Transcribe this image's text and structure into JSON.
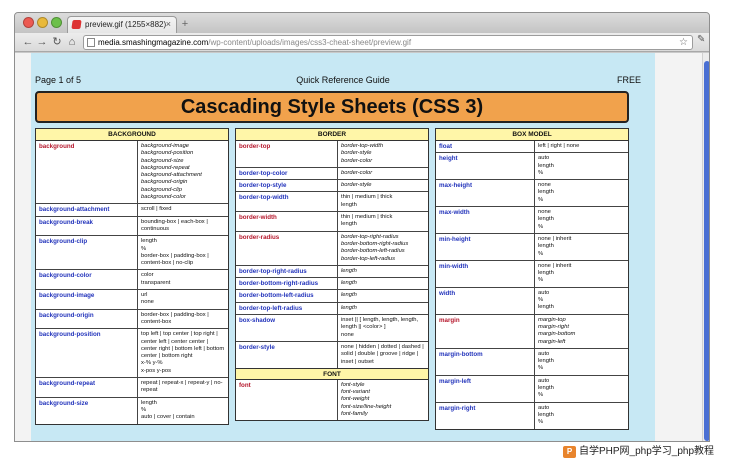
{
  "browser": {
    "tab_title": "preview.gif (1255×882)",
    "tab_close": "×",
    "new_tab": "+",
    "url_host": "media.smashingmagazine.com",
    "url_path": "/wp-content/uploads/images/css3-cheat-sheet/preview.gif",
    "back": "←",
    "forward": "→",
    "reload": "↻",
    "home": "⌂",
    "star": "☆",
    "wrench": "✎"
  },
  "page": {
    "page_label": "Page 1 of 5",
    "guide_label": "Quick Reference Guide",
    "free_label": "FREE",
    "title": "Cascading Style Sheets (CSS 3)"
  },
  "background": {
    "heading": "BACKGROUND",
    "rows": [
      {
        "prop": "background",
        "red": true,
        "italic": true,
        "val": "background-image\nbackground-position\nbackground-size\nbackground-repeat\nbackground-attachment\nbackground-origin\nbackground-clip\nbackground-color"
      },
      {
        "prop": "background-attachment",
        "red": false,
        "italic": false,
        "val": "scroll | fixed"
      },
      {
        "prop": "background-break",
        "red": false,
        "italic": false,
        "val": "bounding-box | each-box | continuous"
      },
      {
        "prop": "background-clip",
        "red": false,
        "italic": false,
        "val": "length\n%\nborder-box | padding-box | content-box | no-clip"
      },
      {
        "prop": "background-color",
        "red": false,
        "italic": false,
        "val": "color\ntransparent"
      },
      {
        "prop": "background-image",
        "red": false,
        "italic": false,
        "val": "url\nnone"
      },
      {
        "prop": "background-origin",
        "red": false,
        "italic": false,
        "val": "border-box | padding-box | content-box"
      },
      {
        "prop": "background-position",
        "red": false,
        "italic": false,
        "val": "top left | top center | top right | center left | center center | center right | bottom left | bottom center | bottom right\nx-% y-%\nx-pos y-pos"
      },
      {
        "prop": "background-repeat",
        "red": false,
        "italic": false,
        "val": "repeat | repeat-x | repeat-y | no-repeat"
      },
      {
        "prop": "background-size",
        "red": false,
        "italic": false,
        "val": "length\n%\nauto | cover | contain"
      }
    ]
  },
  "border": {
    "heading": "BORDER",
    "rows": [
      {
        "prop": "border-top",
        "red": true,
        "italic": true,
        "val": "border-top-width\nborder-style\nborder-color"
      },
      {
        "prop": "border-top-color",
        "red": false,
        "italic": true,
        "val": "border-color"
      },
      {
        "prop": "border-top-style",
        "red": false,
        "italic": true,
        "val": "border-style"
      },
      {
        "prop": "border-top-width",
        "red": false,
        "italic": false,
        "val": "thin | medium | thick\nlength"
      },
      {
        "prop": "border-width",
        "red": true,
        "italic": false,
        "val": "thin | medium | thick\nlength"
      },
      {
        "prop": "border-radius",
        "red": true,
        "italic": true,
        "val": "border-top-right-radius\nborder-bottom-right-radius\nborder-bottom-left-radius\nborder-top-left-radius"
      },
      {
        "prop": "border-top-right-radius",
        "red": false,
        "italic": true,
        "val": "length"
      },
      {
        "prop": "border-bottom-right-radius",
        "red": false,
        "italic": true,
        "val": "length"
      },
      {
        "prop": "border-bottom-left-radius",
        "red": false,
        "italic": true,
        "val": "length"
      },
      {
        "prop": "border-top-left-radius",
        "red": false,
        "italic": true,
        "val": "length"
      },
      {
        "prop": "box-shadow",
        "red": false,
        "italic": false,
        "val": "inset || [ length, length, length, length || <color> ]\nnone"
      },
      {
        "prop": "border-style",
        "red": false,
        "italic": false,
        "val": "none | hidden | dotted | dashed | solid | double | groove | ridge | inset | outset"
      }
    ],
    "font_heading": "FONT",
    "font_rows": [
      {
        "prop": "font",
        "red": true,
        "italic": true,
        "val": "font-style\nfont-variant\nfont-weight\nfont-size/line-height\nfont-family"
      }
    ]
  },
  "box_model": {
    "heading": "BOX MODEL",
    "rows": [
      {
        "prop": "float",
        "red": false,
        "italic": false,
        "val": "left | right | none"
      },
      {
        "prop": "height",
        "red": false,
        "italic": false,
        "val": "auto\nlength\n%"
      },
      {
        "prop": "max-height",
        "red": false,
        "italic": false,
        "val": "none\nlength\n%"
      },
      {
        "prop": "max-width",
        "red": false,
        "italic": false,
        "val": "none\nlength\n%"
      },
      {
        "prop": "min-height",
        "red": false,
        "italic": false,
        "val": "none | inherit\nlength\n%"
      },
      {
        "prop": "min-width",
        "red": false,
        "italic": false,
        "val": "none | inherit\nlength\n%"
      },
      {
        "prop": "width",
        "red": false,
        "italic": false,
        "val": "auto\n%\nlength"
      },
      {
        "prop": "margin",
        "red": true,
        "italic": true,
        "val": "margin-top\nmargin-right\nmargin-bottom\nmargin-left"
      },
      {
        "prop": "margin-bottom",
        "red": false,
        "italic": false,
        "val": "auto\nlength\n%"
      },
      {
        "prop": "margin-left",
        "red": false,
        "italic": false,
        "val": "auto\nlength\n%"
      },
      {
        "prop": "margin-right",
        "red": false,
        "italic": false,
        "val": "auto\nlength\n%"
      }
    ]
  },
  "watermark": {
    "logo": "P",
    "text": "自学PHP网_php学习_php教程"
  }
}
